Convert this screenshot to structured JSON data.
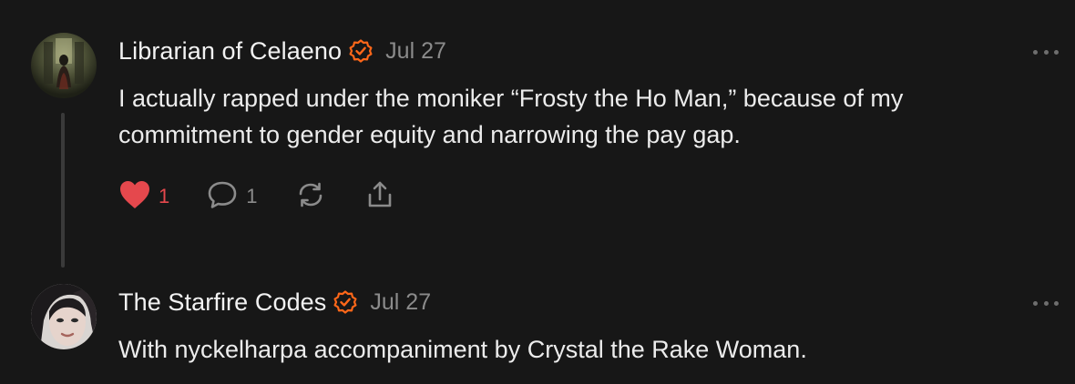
{
  "comments": [
    {
      "author": "Librarian of Celaeno",
      "verified_icon": "verified-check-icon",
      "date": "Jul 27",
      "text": "I actually rapped under the moniker “Frosty the Ho Man,” because of my commitment to gender equity and narrowing the pay gap.",
      "likes": "1",
      "replies": "1",
      "liked": true
    },
    {
      "author": "The Starfire Codes",
      "verified_icon": "verified-check-icon",
      "date": "Jul 27",
      "text": "With nyckelharpa accompaniment by Crystal the Rake Woman."
    }
  ],
  "colors": {
    "accent_orange": "#ff6719",
    "like_red": "#e5484d",
    "muted_gray": "#8b8b8b",
    "background": "#171717"
  },
  "icons": [
    "heart-icon",
    "comment-bubble-icon",
    "restack-icon",
    "share-icon",
    "more-options-icon"
  ]
}
